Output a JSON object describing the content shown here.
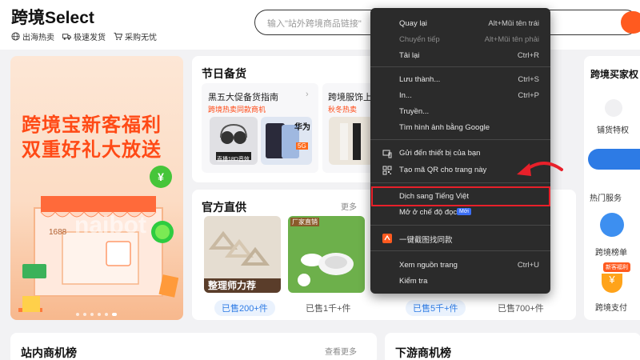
{
  "header": {
    "logo": "跨境Select",
    "features": [
      {
        "icon": "globe-icon",
        "label": "出海热卖"
      },
      {
        "icon": "truck-icon",
        "label": "极速发货"
      },
      {
        "icon": "cart-icon",
        "label": "采购无忧"
      }
    ],
    "search_placeholder": "输入\"站外跨境商品链接\""
  },
  "banner": {
    "line1": "跨境宝新客福利",
    "line2": "双重好礼大放送",
    "shop_sign": "1688",
    "brand_text": "naibot"
  },
  "holiday": {
    "title": "节日备货",
    "cards": [
      {
        "title": "黑五大促备货指南",
        "tag": "跨境热卖同款商机",
        "img_caption": "直播18D音效",
        "brand": "华为",
        "badge": "5G"
      },
      {
        "title": "跨境服饰上新",
        "tag": "秋冬热卖"
      }
    ]
  },
  "official": {
    "title": "官方直供",
    "more": "更多",
    "products": [
      {
        "caption": "整理师力荐",
        "sold": "已售200+件",
        "highlight": true
      },
      {
        "caption": "厂家直销",
        "sold": "已售1千+件",
        "highlight": false
      },
      {
        "sold": "已售5千+件",
        "highlight": true
      },
      {
        "sold": "已售700+件",
        "highlight": false
      }
    ]
  },
  "buyer": {
    "title": "跨境买家权",
    "item1": "铺货特权",
    "hot_title": "热门服务",
    "services": [
      {
        "label": "跨境榜单"
      },
      {
        "label": "跨境支付",
        "badge": "新客福利"
      }
    ]
  },
  "bottom": {
    "left_title": "站内商机榜",
    "left_more": "查看更多",
    "right_title": "下游商机榜"
  },
  "context_menu": {
    "items": [
      {
        "label": "Quay lại",
        "shortcut": "Alt+Mũi tên trái",
        "disabled": false
      },
      {
        "label": "Chuyển tiếp",
        "shortcut": "Alt+Mũi tên phải",
        "disabled": true
      },
      {
        "label": "Tải lại",
        "shortcut": "Ctrl+R",
        "disabled": false
      },
      {
        "label": "Lưu thành...",
        "shortcut": "Ctrl+S",
        "disabled": false
      },
      {
        "label": "In...",
        "shortcut": "Ctrl+P",
        "disabled": false
      },
      {
        "label": "Truyền...",
        "shortcut": "",
        "disabled": false
      },
      {
        "label": "Tìm hình ảnh bằng Google",
        "shortcut": "",
        "disabled": false
      },
      {
        "label": "Gửi đến thiết bị của bạn",
        "shortcut": "",
        "icon": "device-icon",
        "disabled": false
      },
      {
        "label": "Tạo mã QR cho trang này",
        "shortcut": "",
        "icon": "qr-icon",
        "disabled": false
      },
      {
        "label": "Dịch sang Tiếng Việt",
        "shortcut": "",
        "disabled": false,
        "highlighted": true
      },
      {
        "label": "Mở ở chế độ đọc",
        "shortcut": "",
        "badge": "Mới",
        "disabled": false
      },
      {
        "label": "一键截图找同款",
        "shortcut": "",
        "icon": "extension-icon",
        "disabled": false
      },
      {
        "label": "Xem nguồn trang",
        "shortcut": "Ctrl+U",
        "disabled": false
      },
      {
        "label": "Kiểm tra",
        "shortcut": "",
        "disabled": false
      }
    ]
  },
  "colors": {
    "accent": "#ff5a1f",
    "highlight_border": "#e8202a",
    "menu_bg": "#2b2b2b",
    "link_blue": "#2d7be5"
  }
}
